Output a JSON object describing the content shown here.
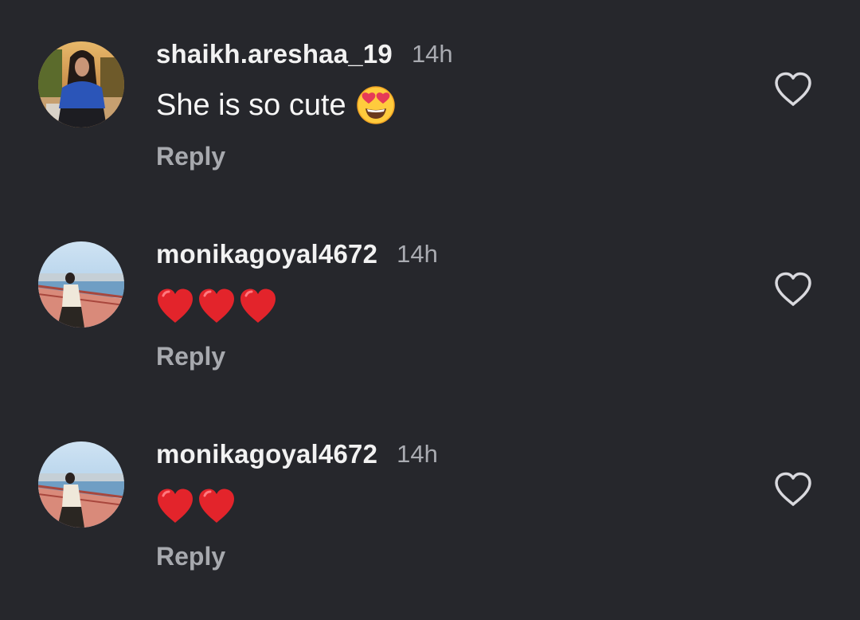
{
  "comments": [
    {
      "username": "shaikh.areshaa_19",
      "time": "14h",
      "text": "She is so cute",
      "emoji": "smiling-face-with-heart-eyes",
      "reply_label": "Reply"
    },
    {
      "username": "monikagoyal4672",
      "time": "14h",
      "text": "",
      "emoji": "red-heart x3",
      "reply_label": "Reply"
    },
    {
      "username": "monikagoyal4672",
      "time": "14h",
      "text": "",
      "emoji": "red-heart x2",
      "reply_label": "Reply"
    }
  ],
  "colors": {
    "background": "#26272c",
    "username": "#f2f2f2",
    "meta": "#a9abb1",
    "heart": "#e3242b"
  }
}
